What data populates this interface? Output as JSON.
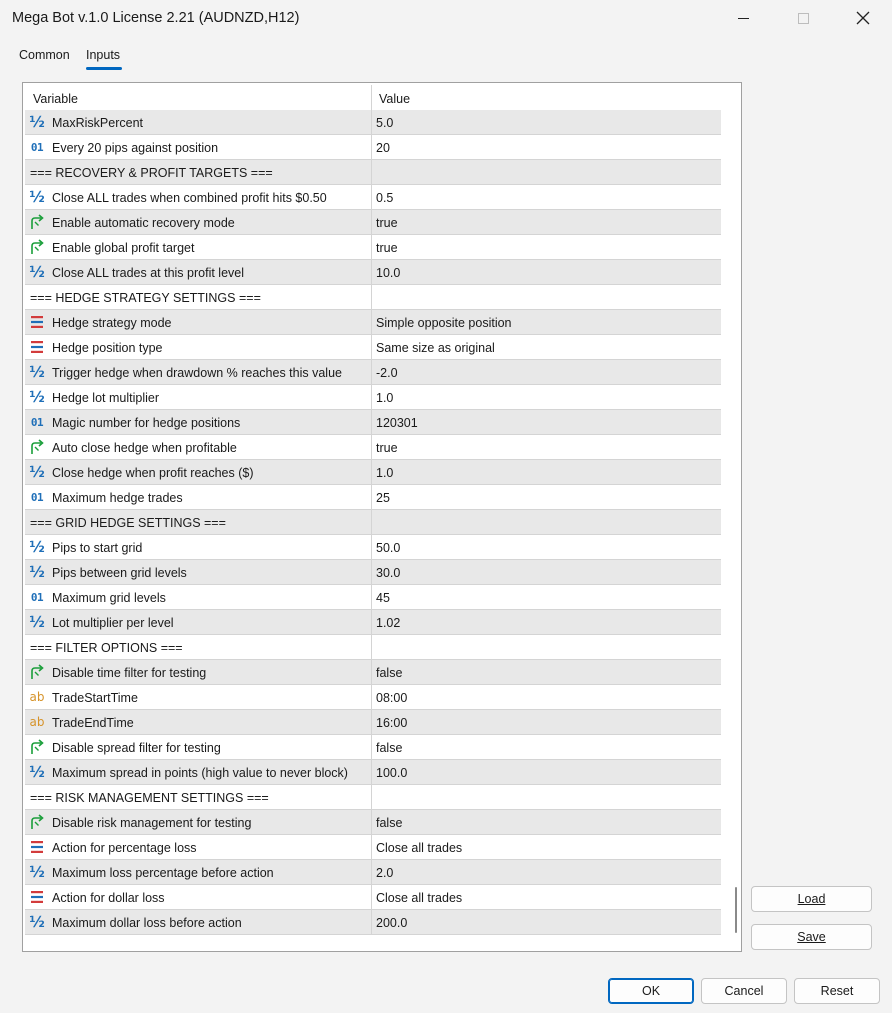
{
  "window": {
    "title": "Mega Bot v.1.0 License 2.21 (AUDNZD,H12)",
    "minimize_icon": "minimize-icon",
    "maximize_icon": "maximize-icon",
    "close_icon": "close-icon"
  },
  "tabs": [
    {
      "label": "Common",
      "active": false
    },
    {
      "label": "Inputs",
      "active": true
    }
  ],
  "grid": {
    "header": {
      "variable": "Variable",
      "value": "Value"
    },
    "rows": [
      {
        "type": "double",
        "icon": "half-icon",
        "name": "MaxRiskPercent",
        "value": "5.0"
      },
      {
        "type": "int",
        "icon": "integer-icon",
        "name": "Every 20 pips against position",
        "value": "20"
      },
      {
        "type": "section",
        "icon": "",
        "name": "=== RECOVERY & PROFIT TARGETS ===",
        "value": ""
      },
      {
        "type": "double",
        "icon": "half-icon",
        "name": "Close ALL trades when combined profit hits $0.50",
        "value": "0.5"
      },
      {
        "type": "bool",
        "icon": "bool-arrow-icon",
        "name": "Enable automatic recovery mode",
        "value": "true"
      },
      {
        "type": "bool",
        "icon": "bool-arrow-icon",
        "name": "Enable global profit target",
        "value": "true"
      },
      {
        "type": "double",
        "icon": "half-icon",
        "name": "Close ALL trades at this profit level",
        "value": "10.0"
      },
      {
        "type": "section",
        "icon": "",
        "name": "=== HEDGE STRATEGY SETTINGS ===",
        "value": ""
      },
      {
        "type": "enum",
        "icon": "enum-list-icon",
        "name": "Hedge strategy mode",
        "value": "Simple opposite position"
      },
      {
        "type": "enum",
        "icon": "enum-list-icon",
        "name": "Hedge position type",
        "value": "Same size as original"
      },
      {
        "type": "double",
        "icon": "half-icon",
        "name": "Trigger hedge when drawdown % reaches this value",
        "value": "-2.0"
      },
      {
        "type": "double",
        "icon": "half-icon",
        "name": "Hedge lot multiplier",
        "value": "1.0"
      },
      {
        "type": "int",
        "icon": "integer-icon",
        "name": "Magic number for hedge positions",
        "value": "120301"
      },
      {
        "type": "bool",
        "icon": "bool-arrow-icon",
        "name": "Auto close hedge when profitable",
        "value": "true"
      },
      {
        "type": "double",
        "icon": "half-icon",
        "name": "Close hedge when profit reaches ($)",
        "value": "1.0"
      },
      {
        "type": "int",
        "icon": "integer-icon",
        "name": "Maximum hedge trades",
        "value": "25"
      },
      {
        "type": "section",
        "icon": "",
        "name": "=== GRID HEDGE SETTINGS ===",
        "value": ""
      },
      {
        "type": "double",
        "icon": "half-icon",
        "name": "Pips to start grid",
        "value": "50.0"
      },
      {
        "type": "double",
        "icon": "half-icon",
        "name": "Pips between grid levels",
        "value": "30.0"
      },
      {
        "type": "int",
        "icon": "integer-icon",
        "name": "Maximum grid levels",
        "value": "45"
      },
      {
        "type": "double",
        "icon": "half-icon",
        "name": "Lot multiplier per level",
        "value": "1.02"
      },
      {
        "type": "section",
        "icon": "",
        "name": "=== FILTER OPTIONS ===",
        "value": ""
      },
      {
        "type": "bool",
        "icon": "bool-arrow-icon",
        "name": "Disable time filter for testing",
        "value": "false"
      },
      {
        "type": "string",
        "icon": "string-ab-icon",
        "name": "TradeStartTime",
        "value": "08:00"
      },
      {
        "type": "string",
        "icon": "string-ab-icon",
        "name": "TradeEndTime",
        "value": "16:00"
      },
      {
        "type": "bool",
        "icon": "bool-arrow-icon",
        "name": "Disable spread filter for testing",
        "value": "false"
      },
      {
        "type": "double",
        "icon": "half-icon",
        "name": "Maximum spread in points (high value to never block)",
        "value": "100.0"
      },
      {
        "type": "section",
        "icon": "",
        "name": "=== RISK MANAGEMENT SETTINGS ===",
        "value": ""
      },
      {
        "type": "bool",
        "icon": "bool-arrow-icon",
        "name": "Disable risk management for testing",
        "value": "false"
      },
      {
        "type": "enum",
        "icon": "enum-list-icon",
        "name": "Action for percentage loss",
        "value": "Close all trades"
      },
      {
        "type": "double",
        "icon": "half-icon",
        "name": "Maximum loss percentage before action",
        "value": "2.0"
      },
      {
        "type": "enum",
        "icon": "enum-list-icon",
        "name": "Action for dollar loss",
        "value": "Close all trades"
      },
      {
        "type": "double",
        "icon": "half-icon",
        "name": "Maximum dollar loss before action",
        "value": "200.0"
      }
    ]
  },
  "side_buttons": {
    "load": "Load",
    "save": "Save"
  },
  "footer": {
    "ok": "OK",
    "cancel": "Cancel",
    "reset": "Reset"
  },
  "colors": {
    "accent": "#0067c0",
    "icon_blue": "#1f6fb8",
    "icon_green": "#1a9e3a",
    "icon_red": "#d23b3b",
    "icon_orange": "#d6932a"
  }
}
